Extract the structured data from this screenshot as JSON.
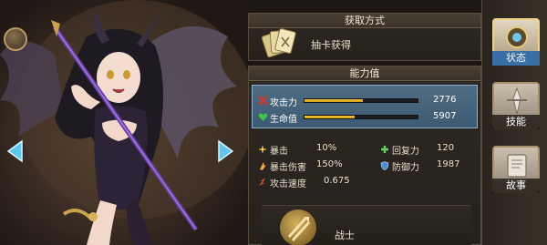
{
  "acquisition": {
    "header": "获取方式",
    "method": "抽卡获得",
    "icon": "card-stack-icon"
  },
  "abilities": {
    "header": "能力值",
    "attack": {
      "label": "攻击力",
      "value": "2776",
      "fill": 0.52,
      "icon": "sword-cross-icon",
      "color": "#d23a2a"
    },
    "hp": {
      "label": "生命值",
      "value": "5907",
      "fill": 0.44,
      "icon": "heart-icon",
      "color": "#3fc44a"
    },
    "stats": [
      {
        "name": "暴击",
        "value": "10%",
        "icon": "crit-icon"
      },
      {
        "name": "回复力",
        "value": "120",
        "icon": "plus-icon"
      },
      {
        "name": "暴击伤害",
        "value": "150%",
        "icon": "crit-damage-icon"
      },
      {
        "name": "防御力",
        "value": "1987",
        "icon": "shield-icon"
      },
      {
        "name": "攻击速度",
        "value": "0.675",
        "icon": "speed-icon"
      }
    ],
    "class_name": "战士"
  },
  "tabs": [
    {
      "label": "状态",
      "icon": "status-gear-icon",
      "active": true
    },
    {
      "label": "技能",
      "icon": "skill-blade-icon",
      "active": false
    },
    {
      "label": "故事",
      "icon": "book-icon",
      "active": false
    }
  ],
  "colors": {
    "bar_fill": "#f5c93a",
    "active_tab": "#3a6fa6",
    "panel_highlight": "#4f6d85"
  }
}
